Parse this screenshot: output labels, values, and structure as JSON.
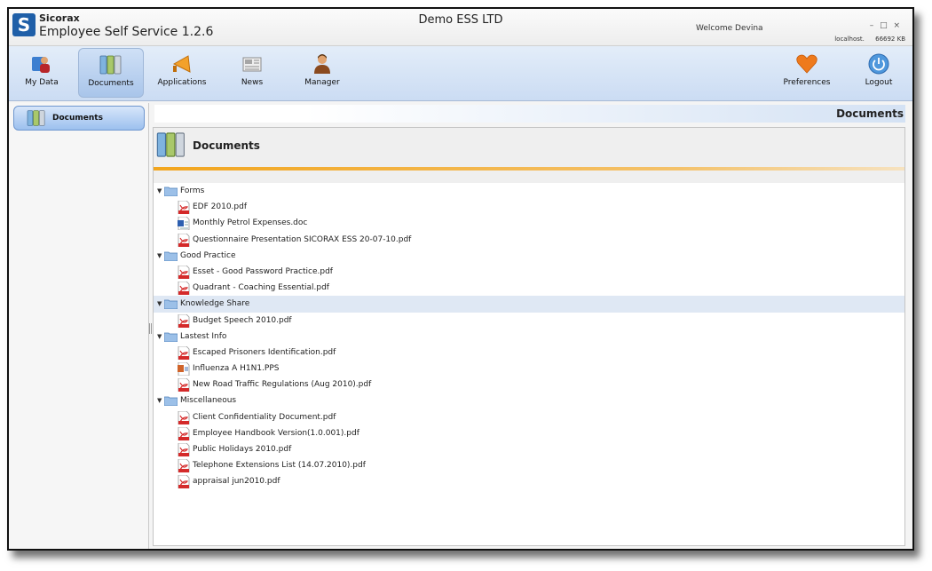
{
  "titlebar": {
    "brand": "Sicorax",
    "logo_letter": "S",
    "product": "Employee Self Service 1.2.6",
    "company": "Demo ESS LTD",
    "welcome": "Welcome Devina",
    "window_controls": "– □ ×",
    "host": "localhost.",
    "memory": "66692 KB"
  },
  "toolbar": {
    "items": [
      {
        "label": "My Data",
        "icon": "my-data-icon"
      },
      {
        "label": "Documents",
        "icon": "documents-icon",
        "active": true
      },
      {
        "label": "Applications",
        "icon": "megaphone-icon"
      },
      {
        "label": "News",
        "icon": "newspaper-icon"
      },
      {
        "label": "Manager",
        "icon": "manager-icon"
      },
      {
        "label": "Preferences",
        "icon": "heart-icon"
      },
      {
        "label": "Logout",
        "icon": "power-icon"
      }
    ]
  },
  "sidebar": {
    "button_label": "Documents"
  },
  "main": {
    "header_title": "Documents",
    "panel_title": "Documents",
    "folders": [
      {
        "name": "Forms",
        "files": [
          {
            "name": "EDF 2010.pdf",
            "type": "pdf"
          },
          {
            "name": "Monthly Petrol Expenses.doc",
            "type": "doc"
          },
          {
            "name": "Questionnaire Presentation SICORAX ESS 20-07-10.pdf",
            "type": "pdf"
          }
        ]
      },
      {
        "name": "Good Practice",
        "files": [
          {
            "name": "Esset - Good Password Practice.pdf",
            "type": "pdf"
          },
          {
            "name": "Quadrant - Coaching Essential.pdf",
            "type": "pdf"
          }
        ]
      },
      {
        "name": "Knowledge Share",
        "selected": true,
        "files": [
          {
            "name": "Budget Speech 2010.pdf",
            "type": "pdf"
          }
        ]
      },
      {
        "name": "Lastest Info",
        "files": [
          {
            "name": "Escaped Prisoners Identification.pdf",
            "type": "pdf"
          },
          {
            "name": "Influenza A H1N1.PPS",
            "type": "pps"
          },
          {
            "name": "New Road Traffic Regulations (Aug 2010).pdf",
            "type": "pdf"
          }
        ]
      },
      {
        "name": "Miscellaneous",
        "files": [
          {
            "name": "Client Confidentiality Document.pdf",
            "type": "pdf"
          },
          {
            "name": "Employee Handbook Version(1.0.001).pdf",
            "type": "pdf"
          },
          {
            "name": "Public Holidays 2010.pdf",
            "type": "pdf"
          },
          {
            "name": "Telephone Extensions List (14.07.2010).pdf",
            "type": "pdf"
          },
          {
            "name": "appraisal jun2010.pdf",
            "type": "pdf"
          }
        ]
      }
    ]
  },
  "colors": {
    "accent": "#f2a51d",
    "toolbar": "#cbdcf3",
    "selection": "#dfe8f4"
  }
}
